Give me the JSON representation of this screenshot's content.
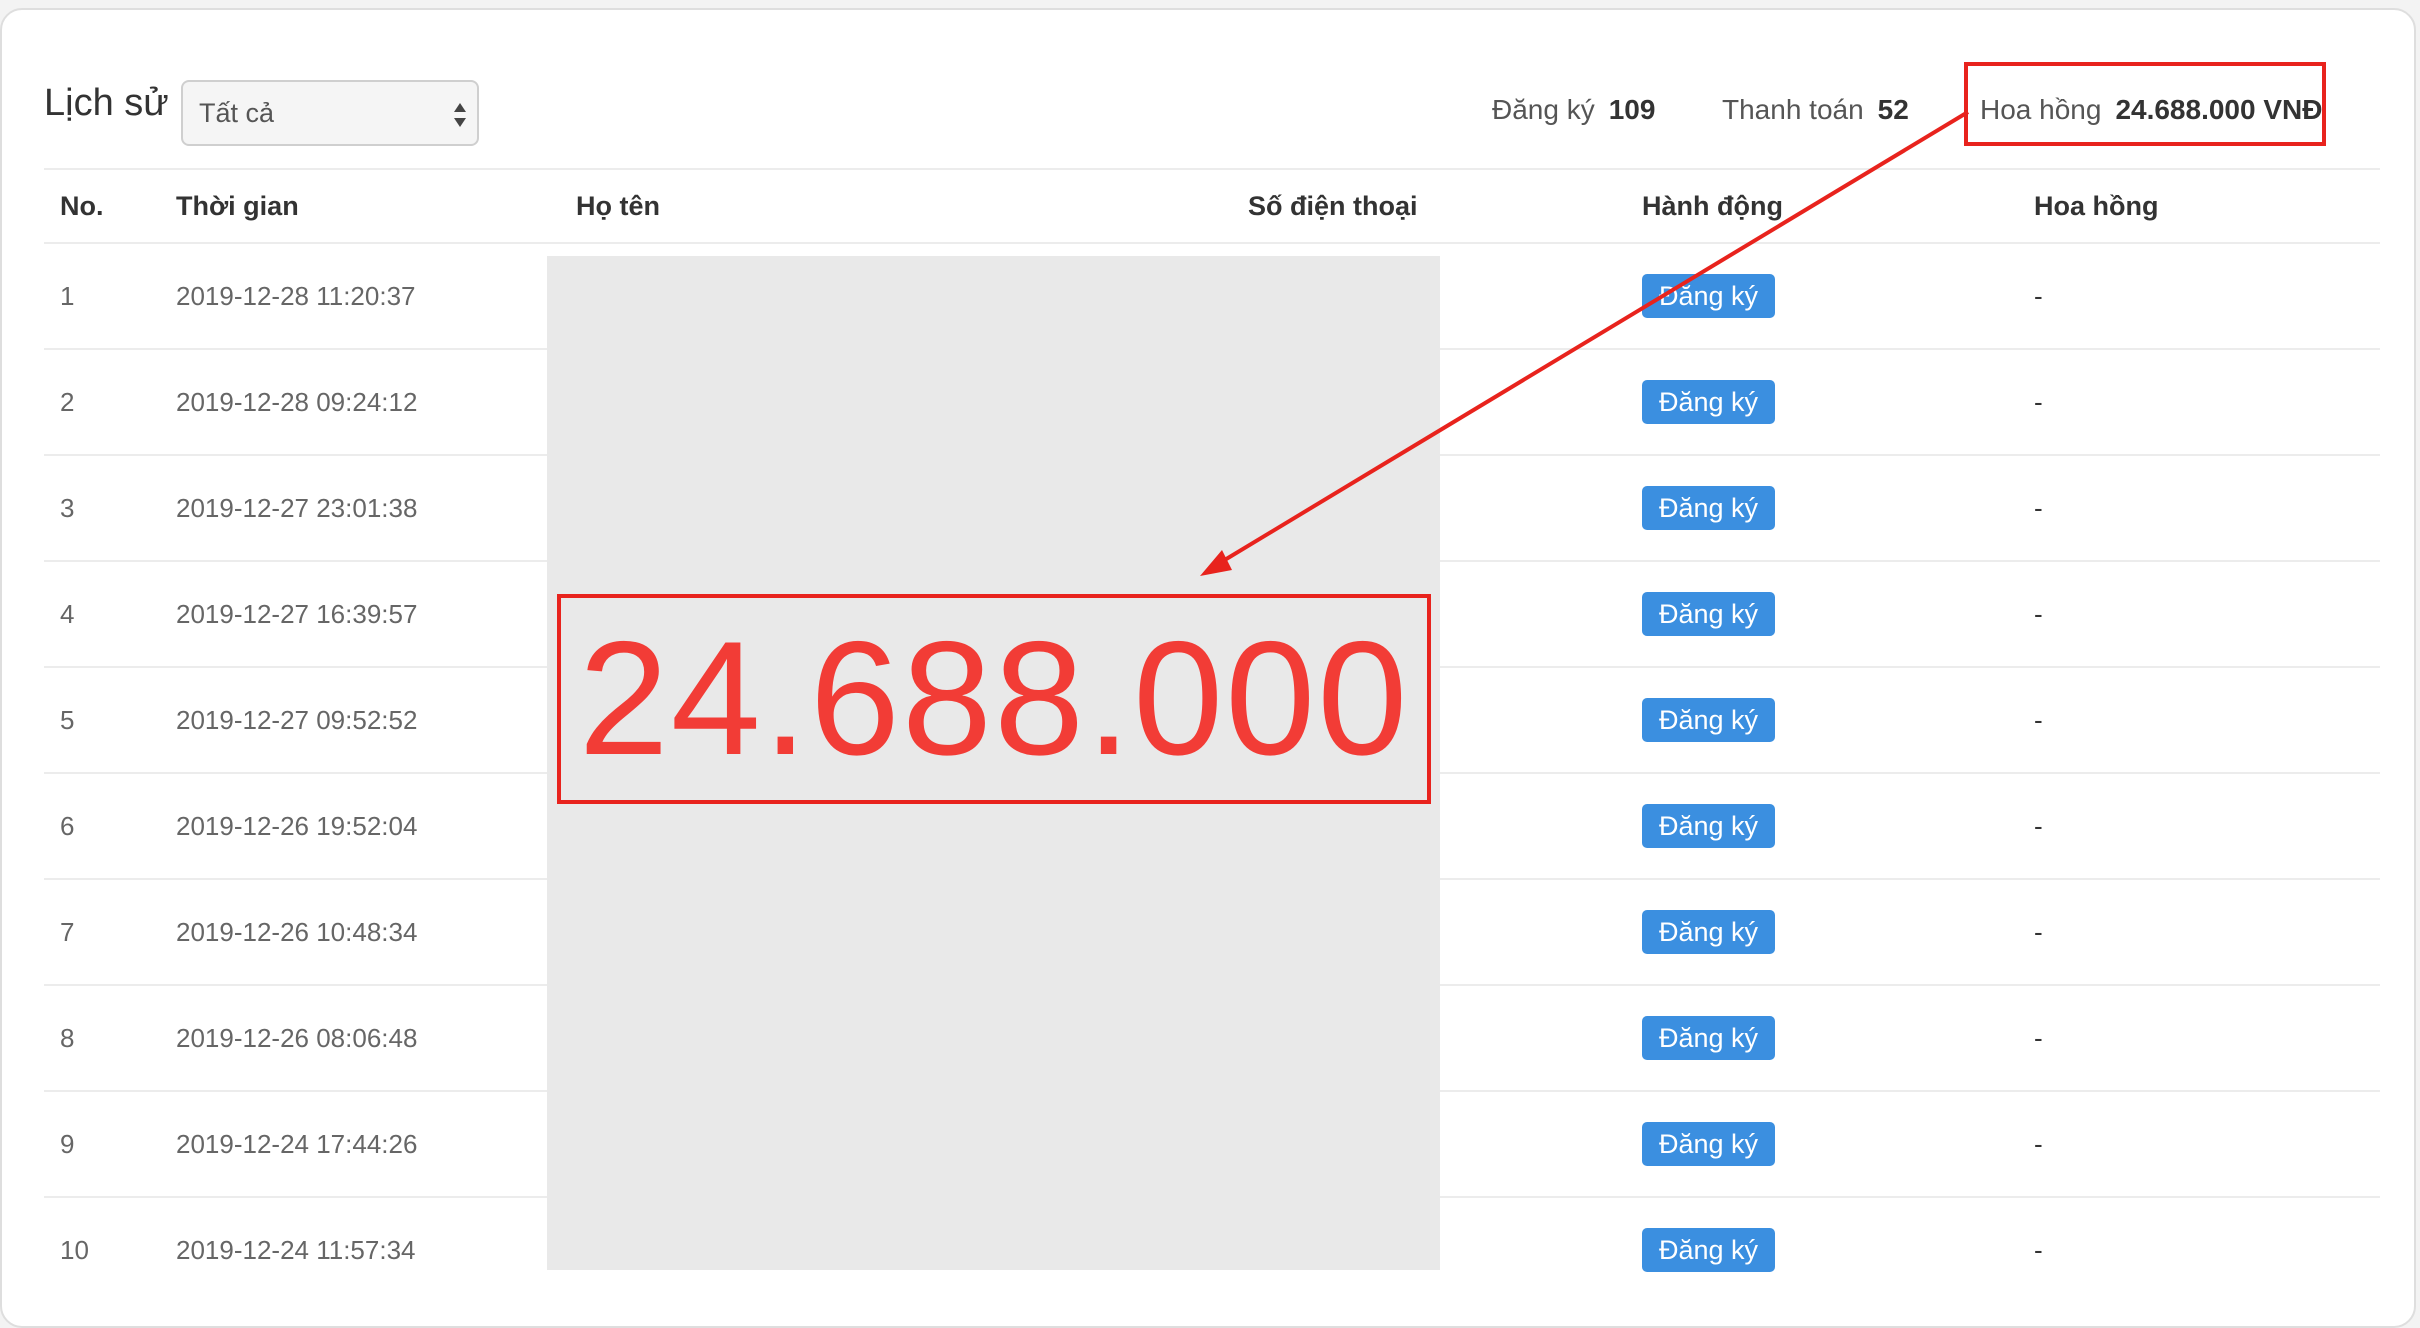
{
  "header": {
    "title": "Lịch sử",
    "filter_value": "Tất cả"
  },
  "stats": {
    "register_label": "Đăng ký",
    "register_value": "109",
    "payment_label": "Thanh toán",
    "payment_value": "52",
    "commission_label": "Hoa hồng",
    "commission_value": "24.688.000 VNĐ"
  },
  "table": {
    "columns": {
      "no": "No.",
      "time": "Thời gian",
      "name": "Họ tên",
      "phone": "Số điện thoại",
      "action": "Hành động",
      "commission": "Hoa hồng"
    },
    "rows": [
      {
        "no": "1",
        "time": "2019-12-28 11:20:37",
        "action": "Đăng ký",
        "commission": "-"
      },
      {
        "no": "2",
        "time": "2019-12-28 09:24:12",
        "action": "Đăng ký",
        "commission": "-"
      },
      {
        "no": "3",
        "time": "2019-12-27 23:01:38",
        "action": "Đăng ký",
        "commission": "-"
      },
      {
        "no": "4",
        "time": "2019-12-27 16:39:57",
        "action": "Đăng ký",
        "commission": "-"
      },
      {
        "no": "5",
        "time": "2019-12-27 09:52:52",
        "action": "Đăng ký",
        "commission": "-"
      },
      {
        "no": "6",
        "time": "2019-12-26 19:52:04",
        "action": "Đăng ký",
        "commission": "-"
      },
      {
        "no": "7",
        "time": "2019-12-26 10:48:34",
        "action": "Đăng ký",
        "commission": "-"
      },
      {
        "no": "8",
        "time": "2019-12-26 08:06:48",
        "action": "Đăng ký",
        "commission": "-"
      },
      {
        "no": "9",
        "time": "2019-12-24 17:44:26",
        "action": "Đăng ký",
        "commission": "-"
      },
      {
        "no": "10",
        "time": "2019-12-24 11:57:34",
        "action": "Đăng ký",
        "commission": "-"
      }
    ]
  },
  "annotation": {
    "big_number": "24.688.000",
    "color": "#e8231d"
  },
  "colors": {
    "badge": "#3b8fe0",
    "annotation_red": "#e8231d"
  }
}
